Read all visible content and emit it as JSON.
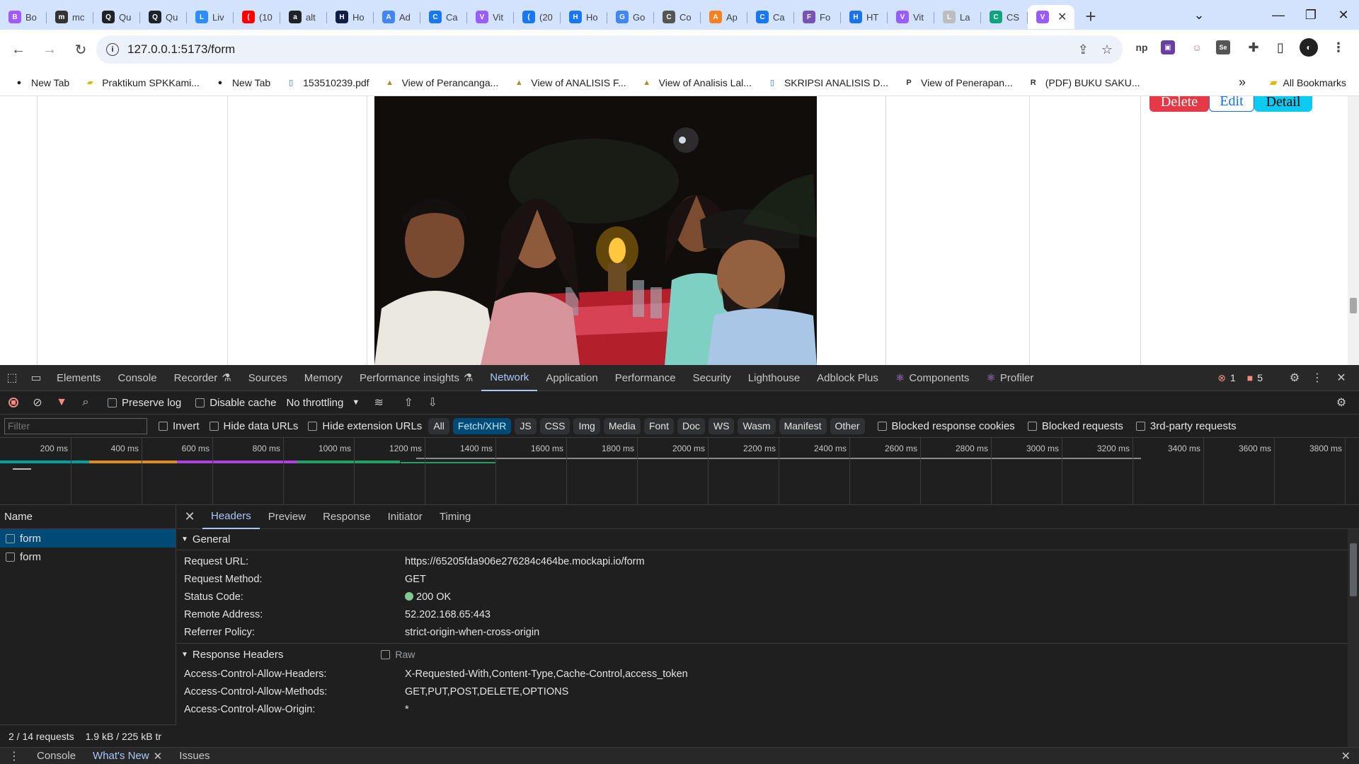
{
  "browser": {
    "tabs": [
      {
        "label": "Bo",
        "icon": "figma-icon",
        "color": "#a259ff"
      },
      {
        "label": "mc",
        "icon": "api-icon",
        "color": "#333333"
      },
      {
        "label": "Qu",
        "icon": "github-icon",
        "color": "#1f2328"
      },
      {
        "label": "Qu",
        "icon": "github-icon",
        "color": "#1f2328"
      },
      {
        "label": "Liv",
        "icon": "zoom-icon",
        "color": "#2d8cff"
      },
      {
        "label": "(10",
        "icon": "youtube-icon",
        "color": "#ff0000"
      },
      {
        "label": "alt",
        "icon": "github-icon",
        "color": "#1f2328"
      },
      {
        "label": "Ho",
        "icon": "app-icon",
        "color": "#0f1e45"
      },
      {
        "label": "Ad",
        "icon": "google-icon",
        "color": "#4285f4"
      },
      {
        "label": "Ca",
        "icon": "messenger-icon",
        "color": "#1877f2"
      },
      {
        "label": "Vit",
        "icon": "vite-icon",
        "color": "#9b5cff"
      },
      {
        "label": "(20",
        "icon": "facebook-icon",
        "color": "#1877f2"
      },
      {
        "label": "Ho",
        "icon": "messenger-icon",
        "color": "#1877f2"
      },
      {
        "label": "Go",
        "icon": "translate-icon",
        "color": "#4285f4"
      },
      {
        "label": "Co",
        "icon": "onenote-icon",
        "color": "#555555"
      },
      {
        "label": "Ap",
        "icon": "box-icon",
        "color": "#f58220"
      },
      {
        "label": "Ca",
        "icon": "messenger-icon",
        "color": "#1877f2"
      },
      {
        "label": "Fo",
        "icon": "bootstrap-icon",
        "color": "#7952b3"
      },
      {
        "label": "HT",
        "icon": "web-icon",
        "color": "#1a73e8"
      },
      {
        "label": "Vit",
        "icon": "vite-icon",
        "color": "#9b5cff"
      },
      {
        "label": "La",
        "icon": "circle-icon",
        "color": "#bdbdbd"
      },
      {
        "label": "CS",
        "icon": "openai-icon",
        "color": "#10a37f"
      }
    ],
    "active_tab": {
      "icon": "vite-icon",
      "color": "#9b5cff"
    },
    "url": "127.0.0.1:5173/form",
    "bookmarks": [
      {
        "label": "New Tab",
        "icon": "github-icon"
      },
      {
        "label": "Praktikum SPKKami...",
        "icon": "folder-icon"
      },
      {
        "label": "New Tab",
        "icon": "github-icon"
      },
      {
        "label": "153510239.pdf",
        "icon": "document-icon"
      },
      {
        "label": "View of Perancanga...",
        "icon": "journal-icon"
      },
      {
        "label": "View of ANALISIS F...",
        "icon": "journal-icon"
      },
      {
        "label": "View of Analisis Lal...",
        "icon": "journal-icon"
      },
      {
        "label": "SKRIPSI ANALISIS D...",
        "icon": "document-icon"
      },
      {
        "label": "View of Penerapan...",
        "icon": "pkp-icon"
      },
      {
        "label": "(PDF) BUKU SAKU...",
        "icon": "researchgate-icon"
      }
    ],
    "more_bookmarks": "»",
    "all_bookmarks": "All Bookmarks"
  },
  "page": {
    "buttons": {
      "delete": "Delete",
      "edit": "Edit",
      "detail": "Detail"
    },
    "colors": {
      "delete": "#e63946",
      "detail": "#0dcaf0"
    }
  },
  "devtools": {
    "tabs": [
      "Elements",
      "Console",
      "Recorder",
      "Sources",
      "Memory",
      "Performance insights",
      "Network",
      "Application",
      "Performance",
      "Security",
      "Lighthouse",
      "Adblock Plus",
      "Components",
      "Profiler"
    ],
    "active_tab": "Network",
    "errors": "1",
    "warnings": "5",
    "toolbar": {
      "preserve_log": "Preserve log",
      "disable_cache": "Disable cache",
      "throttling": "No throttling"
    },
    "filter": {
      "placeholder": "Filter",
      "invert": "Invert",
      "hide_data_urls": "Hide data URLs",
      "hide_extension_urls": "Hide extension URLs",
      "chips": [
        "All",
        "Fetch/XHR",
        "JS",
        "CSS",
        "Img",
        "Media",
        "Font",
        "Doc",
        "WS",
        "Wasm",
        "Manifest",
        "Other"
      ],
      "selected_chip": "Fetch/XHR",
      "blocked_response_cookies": "Blocked response cookies",
      "blocked_requests": "Blocked requests",
      "third_party": "3rd-party requests"
    },
    "timeline_ticks": [
      "200 ms",
      "400 ms",
      "600 ms",
      "800 ms",
      "1000 ms",
      "1200 ms",
      "1400 ms",
      "1600 ms",
      "1800 ms",
      "2000 ms",
      "2200 ms",
      "2400 ms",
      "2600 ms",
      "2800 ms",
      "3000 ms",
      "3200 ms",
      "3400 ms",
      "3600 ms",
      "3800 ms"
    ],
    "requests": {
      "header": "Name",
      "rows": [
        "form",
        "form"
      ]
    },
    "summary": {
      "requests": "2 / 14 requests",
      "transferred": "1.9 kB / 225 kB tr"
    },
    "detail_tabs": [
      "Headers",
      "Preview",
      "Response",
      "Initiator",
      "Timing"
    ],
    "active_detail_tab": "Headers",
    "general": {
      "title": "General",
      "rows": [
        {
          "key": "Request URL:",
          "value": "https://65205fda906e276284c464be.mockapi.io/form"
        },
        {
          "key": "Request Method:",
          "value": "GET"
        },
        {
          "key": "Status Code:",
          "value": "200 OK"
        },
        {
          "key": "Remote Address:",
          "value": "52.202.168.65:443"
        },
        {
          "key": "Referrer Policy:",
          "value": "strict-origin-when-cross-origin"
        }
      ]
    },
    "response_headers": {
      "title": "Response Headers",
      "raw": "Raw",
      "rows": [
        {
          "key": "Access-Control-Allow-Headers:",
          "value": "X-Requested-With,Content-Type,Cache-Control,access_token"
        },
        {
          "key": "Access-Control-Allow-Methods:",
          "value": "GET,PUT,POST,DELETE,OPTIONS"
        },
        {
          "key": "Access-Control-Allow-Origin:",
          "value": "*"
        }
      ]
    },
    "drawer_tabs": [
      "Console",
      "What's New",
      "Issues"
    ],
    "active_drawer_tab": "What's New"
  }
}
